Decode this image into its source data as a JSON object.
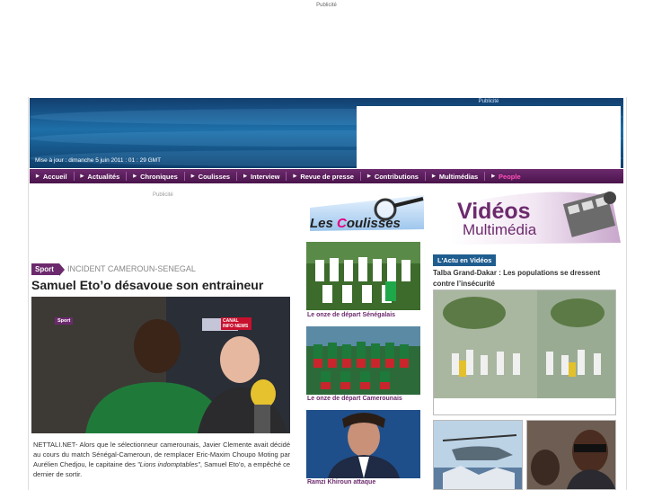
{
  "top_ad": {
    "label": "Publicité"
  },
  "header": {
    "ad_label": "Publicité",
    "update_text": "Mise à jour : dimanche 5 juin 2011 : 01 : 29 GMT"
  },
  "nav": {
    "items": [
      {
        "label": "Accueil"
      },
      {
        "label": "Actualités"
      },
      {
        "label": "Chroniques"
      },
      {
        "label": "Coulisses"
      },
      {
        "label": "Interview"
      },
      {
        "label": "Revue de presse"
      },
      {
        "label": "Contributions"
      },
      {
        "label": "Multimédias"
      },
      {
        "label": "People"
      }
    ],
    "colors": {
      "bar": "#5a1f5c",
      "people": "#ff4fb8"
    }
  },
  "main": {
    "ad_label": "Publicité",
    "section_tag": "Sport",
    "kicker": "INCIDENT CAMEROUN-SENEGAL",
    "headline": "Samuel Eto’o désavoue son entraineur",
    "photo_tag": "Sport",
    "tv_logo": "CANAL INFO NEWS",
    "article_part1": "NETTALI.NET- Alors que le sélectionneur camerounais, Javier Clemente avait décidé au cours du match Sénégal-Cameroun, de remplacer Eric-Maxim Choupo Moting par Aurélien Chedjou, le capitaine des ",
    "article_quote": "\"Lions indomptables\"",
    "article_part2": ", Samuel Eto’o, a empêché ce dernier de sortir."
  },
  "coulisses": {
    "logo_text_1": "Les ",
    "logo_text_2": "C",
    "logo_text_3": "oulisses",
    "items": [
      {
        "caption": "Le onze de départ Sénégalais"
      },
      {
        "caption": "Le onze de départ Camerounais"
      },
      {
        "caption": "Ramzi Khiroun attaque"
      }
    ]
  },
  "videos": {
    "logo_line1": "Vidéos",
    "logo_line2": "Multimédia",
    "tag": "L'Actu en Vidéos",
    "title": "Talba Grand-Dakar : Les populations se dressent contre l’insécurité"
  }
}
